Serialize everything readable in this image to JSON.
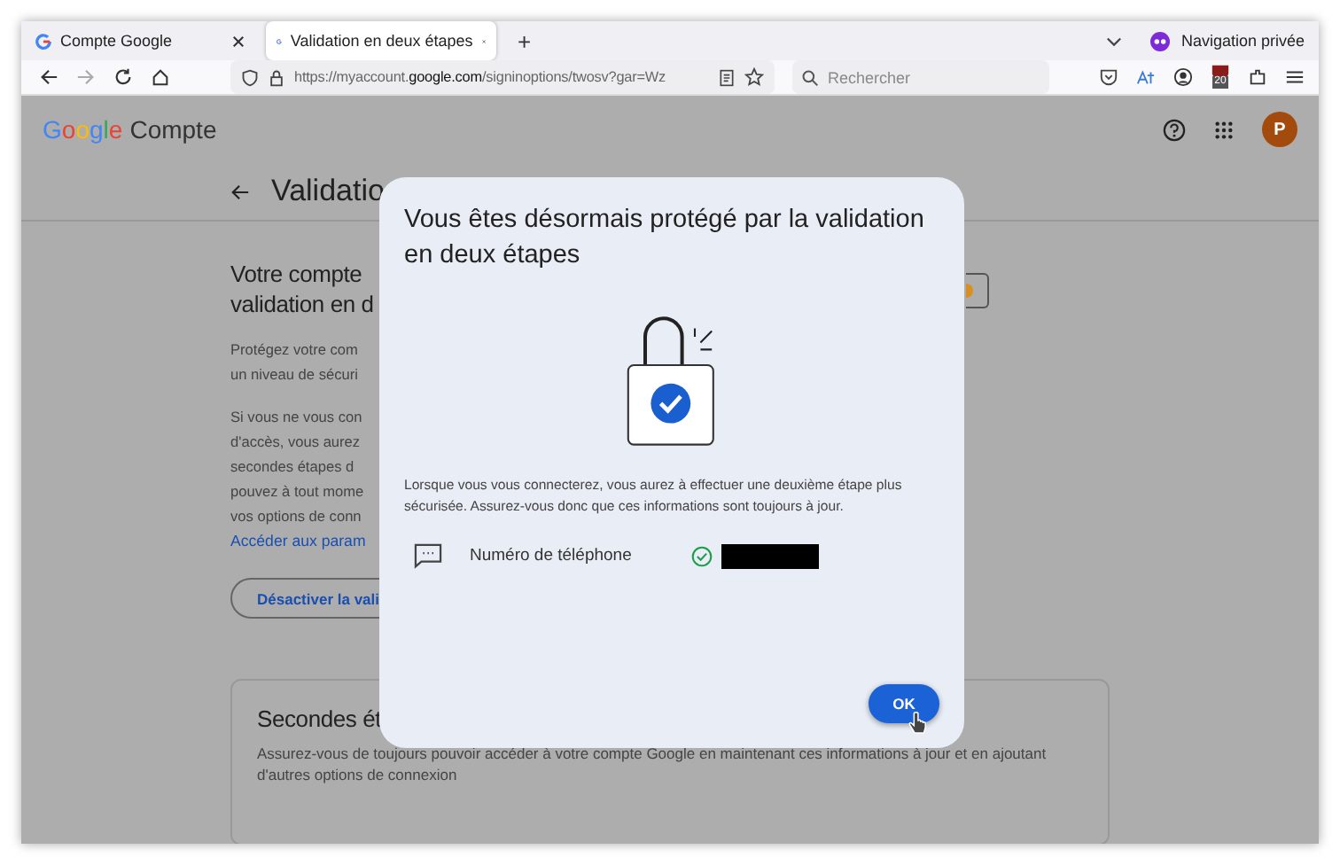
{
  "browser": {
    "tabs": [
      {
        "label": "Compte Google",
        "selected": false
      },
      {
        "label": "Validation en deux étapes",
        "selected": true
      }
    ],
    "new_tab": "+",
    "private_label": "Navigation privée",
    "url": {
      "scheme": "https://myaccount.",
      "host": "google.com",
      "path": "/signinoptions/twosv?gar=Wz"
    },
    "search": {
      "placeholder": "Rechercher"
    },
    "badge": "20"
  },
  "header": {
    "logo": "Google",
    "product": "Compte",
    "avatar": "P"
  },
  "page": {
    "title": "Validatio",
    "heading_lines": [
      "Votre compte",
      "validation en d"
    ],
    "para1_lines": [
      "Protégez votre com",
      "un niveau de sécuri"
    ],
    "para2_lines": [
      "Si vous ne vous con",
      "d'accès, vous aurez",
      "secondes étapes d",
      "pouvez à tout mome",
      "vos options de conn"
    ],
    "link": "Accéder aux param",
    "button": "Désactiver la vali",
    "card": {
      "title": "Secondes ét",
      "text": "Assurez-vous de toujours pouvoir accéder à votre compte Google en maintenant ces informations à jour et en ajoutant d'autres options de connexion"
    }
  },
  "dialog": {
    "title": "Vous êtes désormais protégé par la validation en deux étapes",
    "text": "Lorsque vous vous connecterez, vous aurez à effectuer une deuxième étape plus sécurisée. Assurez-vous donc que ces informations sont toujours à jour.",
    "method": {
      "label": "Numéro de téléphone",
      "verified": true
    },
    "ok": "OK"
  }
}
